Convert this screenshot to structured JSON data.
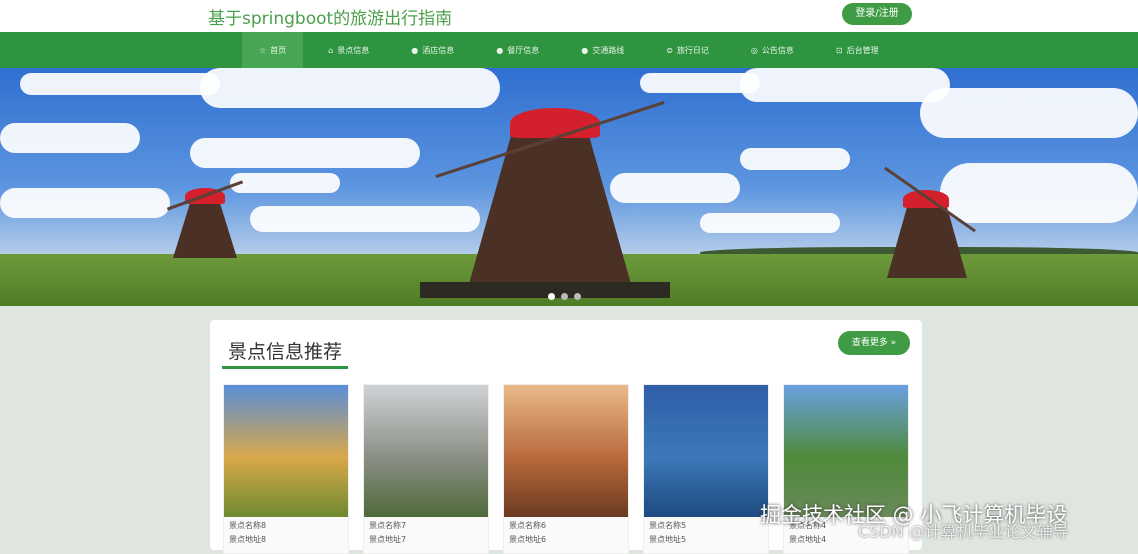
{
  "header": {
    "title": "基于springboot的旅游出行指南",
    "login_label": "登录/注册"
  },
  "nav": [
    {
      "label": "首页",
      "icon": "☆"
    },
    {
      "label": "景点信息",
      "icon": "⌂"
    },
    {
      "label": "酒店信息",
      "icon": "●"
    },
    {
      "label": "餐厅信息",
      "icon": "●"
    },
    {
      "label": "交通路线",
      "icon": "●"
    },
    {
      "label": "旅行日记",
      "icon": "⊜"
    },
    {
      "label": "公告信息",
      "icon": "◎"
    },
    {
      "label": "后台管理",
      "icon": "⊡"
    }
  ],
  "section": {
    "title": "景点信息推荐",
    "more_label": "查看更多 »"
  },
  "cards": [
    {
      "name": "景点名称8",
      "addr": "景点地址8",
      "colors": [
        "#5a8ed8",
        "#d9a84a",
        "#6e8a30"
      ]
    },
    {
      "name": "景点名称7",
      "addr": "景点地址7",
      "colors": [
        "#cfd3d6",
        "#8a8f85",
        "#4f6a3a"
      ]
    },
    {
      "name": "景点名称6",
      "addr": "景点地址6",
      "colors": [
        "#e9b98a",
        "#b86a3c",
        "#6a3a22"
      ]
    },
    {
      "name": "景点名称5",
      "addr": "景点地址5",
      "colors": [
        "#2f5fa8",
        "#3c78b8",
        "#1e4a80"
      ]
    },
    {
      "name": "景点名称4",
      "addr": "景点地址4",
      "colors": [
        "#6aa0e0",
        "#4f8a3a",
        "#6a8a5a"
      ]
    }
  ],
  "watermark": {
    "line1": "掘金技术社区 @ 小飞计算机毕设",
    "line2": "CSDN @计算机毕业论文辅导"
  }
}
